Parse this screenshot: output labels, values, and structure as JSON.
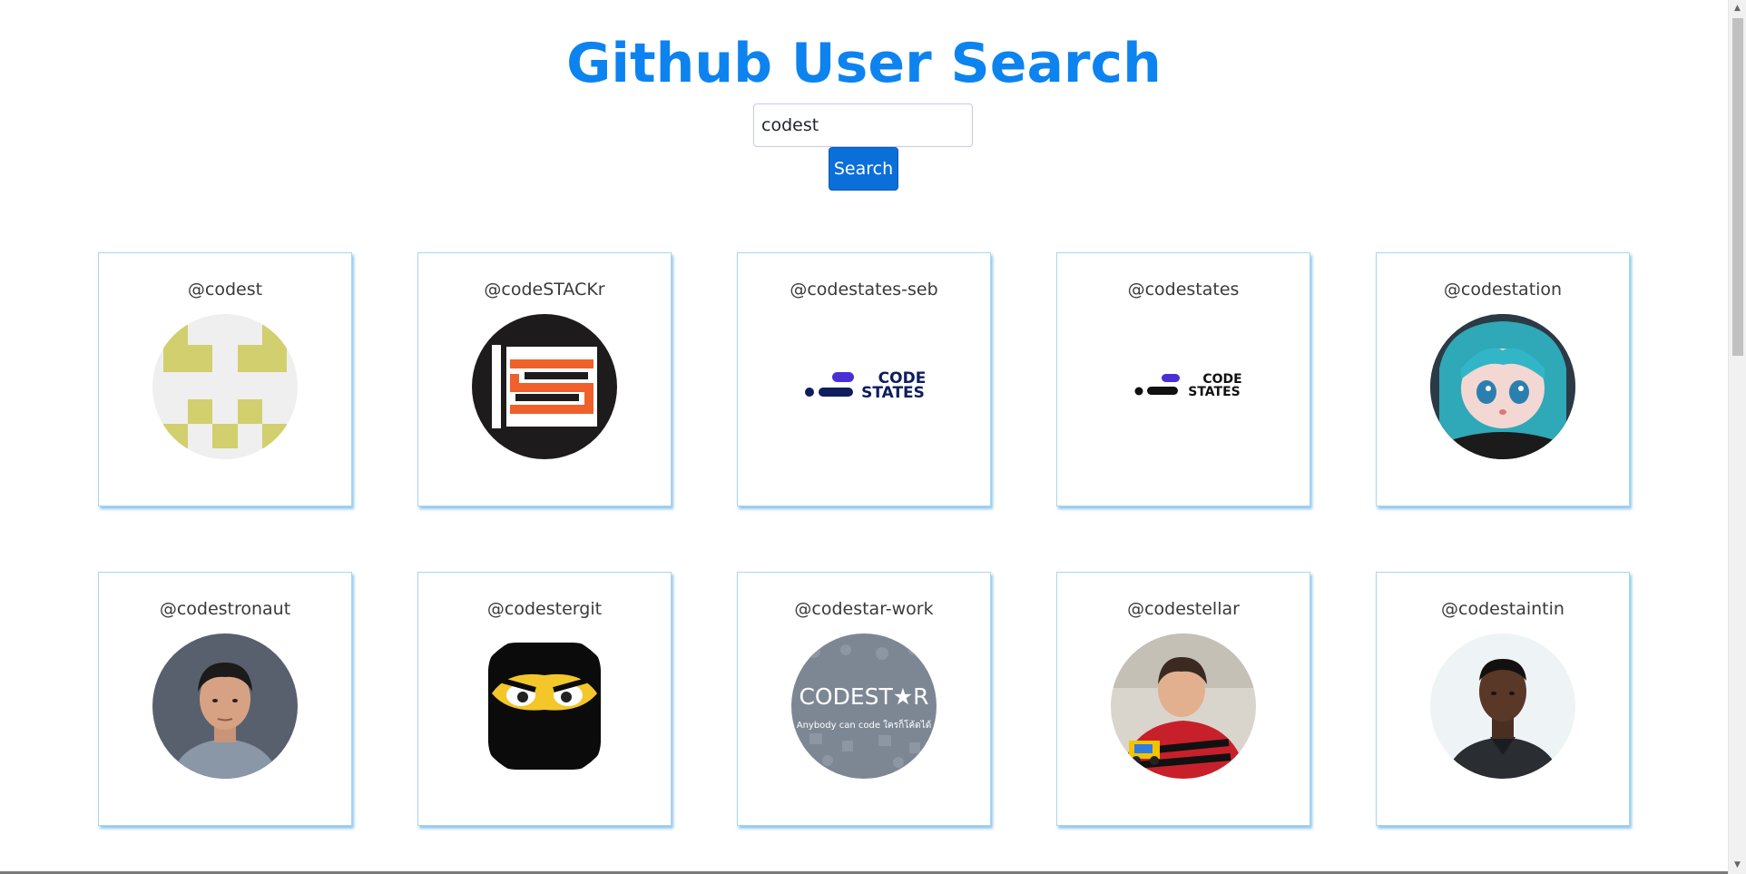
{
  "header": {
    "title": "Github User Search"
  },
  "search": {
    "value": "codest",
    "button_label": "Search"
  },
  "users": [
    {
      "username": "@codest",
      "avatar": "identicon-avatar"
    },
    {
      "username": "@codeSTACKr",
      "avatar": "stack-logo-avatar"
    },
    {
      "username": "@codestates-seb",
      "avatar": "codestates-logo-avatar",
      "logo_text": [
        "CODE",
        "STATES"
      ]
    },
    {
      "username": "@codestates",
      "avatar": "codestates-logo-avatar",
      "logo_text": [
        "CODE",
        "STATES"
      ]
    },
    {
      "username": "@codestation",
      "avatar": "anime-character-avatar"
    },
    {
      "username": "@codestronaut",
      "avatar": "person-photo-avatar"
    },
    {
      "username": "@codestergit",
      "avatar": "ninja-mask-avatar"
    },
    {
      "username": "@codestar-work",
      "avatar": "codestar-logo-avatar",
      "logo_text": [
        "CODEST★R",
        "Anybody can code ใครก็โค้ดได้"
      ]
    },
    {
      "username": "@codestellar",
      "avatar": "child-photo-avatar"
    },
    {
      "username": "@codestaintin",
      "avatar": "person-photo-avatar"
    }
  ],
  "colors": {
    "accent": "#0d83f0",
    "button": "#0a6fd8",
    "card_shadow": "#3498db"
  }
}
